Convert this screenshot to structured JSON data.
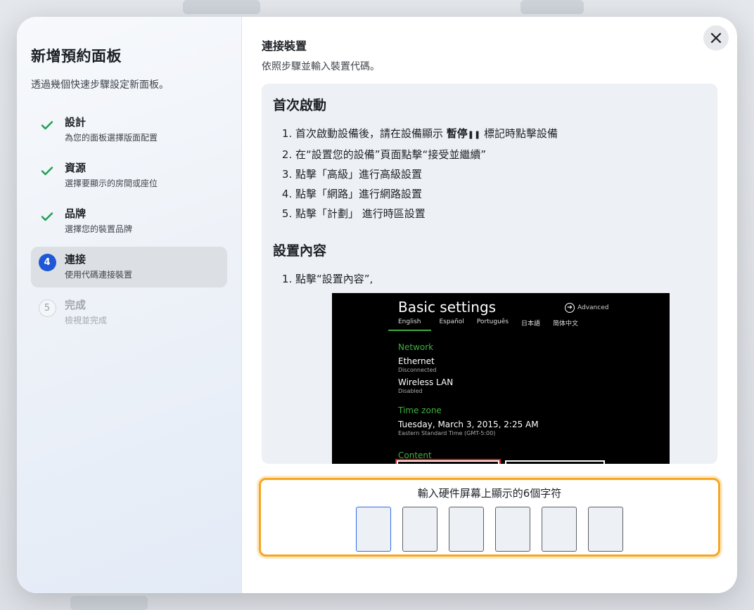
{
  "sidebar": {
    "title": "新增預約面板",
    "subtitle": "透過幾個快速步驟設定新面板。",
    "steps": [
      {
        "title": "設計",
        "desc": "為您的面板選擇版面配置",
        "state": "done"
      },
      {
        "title": "資源",
        "desc": "選擇要顯示的房間或座位",
        "state": "done"
      },
      {
        "title": "品牌",
        "desc": "選擇您的裝置品牌",
        "state": "done"
      },
      {
        "number": "4",
        "title": "連接",
        "desc": "使用代碼連接裝置",
        "state": "active"
      },
      {
        "number": "5",
        "title": "完成",
        "desc": "檢視並完成",
        "state": "pending"
      }
    ]
  },
  "main": {
    "title": "連接裝置",
    "subtitle": "依照步驟並輸入裝置代碼。",
    "close_icon": "close-icon",
    "guide": {
      "section1_title": "首次啟動",
      "section1_items": [
        {
          "pre": "首次啟動設備後，請在設備顯示 ",
          "bold": "暫停",
          "post": " 標記時點擊設備"
        },
        {
          "pre": "在“設置您的設備”頁面點擊“接受並繼續”",
          "bold": "",
          "post": ""
        },
        {
          "pre": "點擊「高級」進行高級設置",
          "bold": "",
          "post": ""
        },
        {
          "pre": "點擊「網路」進行網路設置",
          "bold": "",
          "post": ""
        },
        {
          "pre": "點擊「計劃」 進行時區設置",
          "bold": "",
          "post": ""
        }
      ],
      "section2_title": "設置內容",
      "section2_items": [
        "點擊“設置內容”,"
      ],
      "device_screen": {
        "title": "Basic settings",
        "advanced": "Advanced",
        "languages": [
          "English",
          "Español",
          "Português",
          "日本語",
          "简体中文"
        ],
        "network_label": "Network",
        "ethernet": "Ethernet",
        "ethernet_status": "Disconnected",
        "wifi": "Wireless LAN",
        "wifi_status": "Disabled",
        "timezone_label": "Time zone",
        "datetime": "Tuesday, March 3, 2015, 2:25 AM",
        "timezone": "Eastern Standard Time (GMT-5:00)",
        "content_label": "Content"
      }
    },
    "code": {
      "label": "輸入硬件屏幕上顯示的6個字符",
      "values": [
        "",
        "",
        "",
        "",
        "",
        ""
      ]
    }
  },
  "colors": {
    "accent": "#1f57d6",
    "check": "#1f9d55",
    "highlight": "#f5a623"
  }
}
